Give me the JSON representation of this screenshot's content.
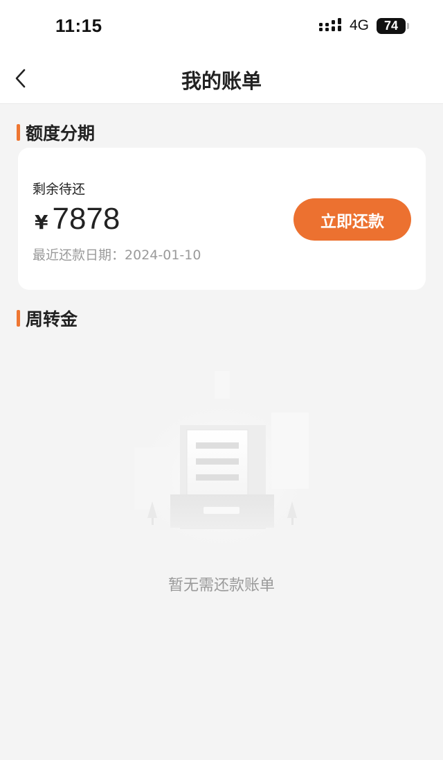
{
  "status_bar": {
    "time": "11:15",
    "network": "4G",
    "battery": "74"
  },
  "nav": {
    "title": "我的账单"
  },
  "installment": {
    "section_title": "额度分期",
    "remaining_label": "剩余待还",
    "currency": "¥",
    "amount": "7878",
    "due_label": "最近还款日期：",
    "due_date": "2024-01-10",
    "repay_button": "立即还款"
  },
  "revolving": {
    "section_title": "周转金",
    "empty_text": "暂无需还款账单"
  },
  "colors": {
    "accent": "#ec7130",
    "background": "#f4f4f4"
  }
}
